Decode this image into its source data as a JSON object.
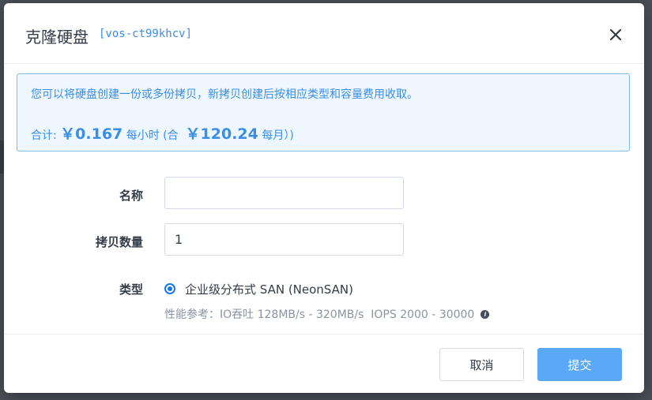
{
  "dialog": {
    "title": "克隆硬盘",
    "volume_id": "[vos-ct99khcv]"
  },
  "notice": {
    "message": "您可以将硬盘创建一份或多份拷贝，新拷贝创建后按相应类型和容量费用收取。",
    "total_prefix": "合计: ",
    "hourly_price": "￥0.167",
    "hourly_unit": " 每小时 (合  ",
    "monthly_price": "￥120.24",
    "monthly_unit": " 每月）)"
  },
  "form": {
    "name_label": "名称",
    "name_value": "",
    "copies_label": "拷贝数量",
    "copies_value": "1",
    "type_label": "类型",
    "type_option": "企业级分布式 SAN (NeonSAN)",
    "type_selected": true,
    "performance": "性能参考：IO吞吐 128MB/s - 320MB/s  IOPS 2000 - 30000"
  },
  "buttons": {
    "cancel": "取消",
    "submit": "提交"
  },
  "icons": {
    "close": "close-icon",
    "info": "info-icon",
    "radio": "radio-selected-icon"
  },
  "colors": {
    "accent": "#3a8ee6",
    "submit_bg": "#5aa9f6",
    "notice_bg": "#eef7fd",
    "notice_border": "#7fbde9"
  }
}
